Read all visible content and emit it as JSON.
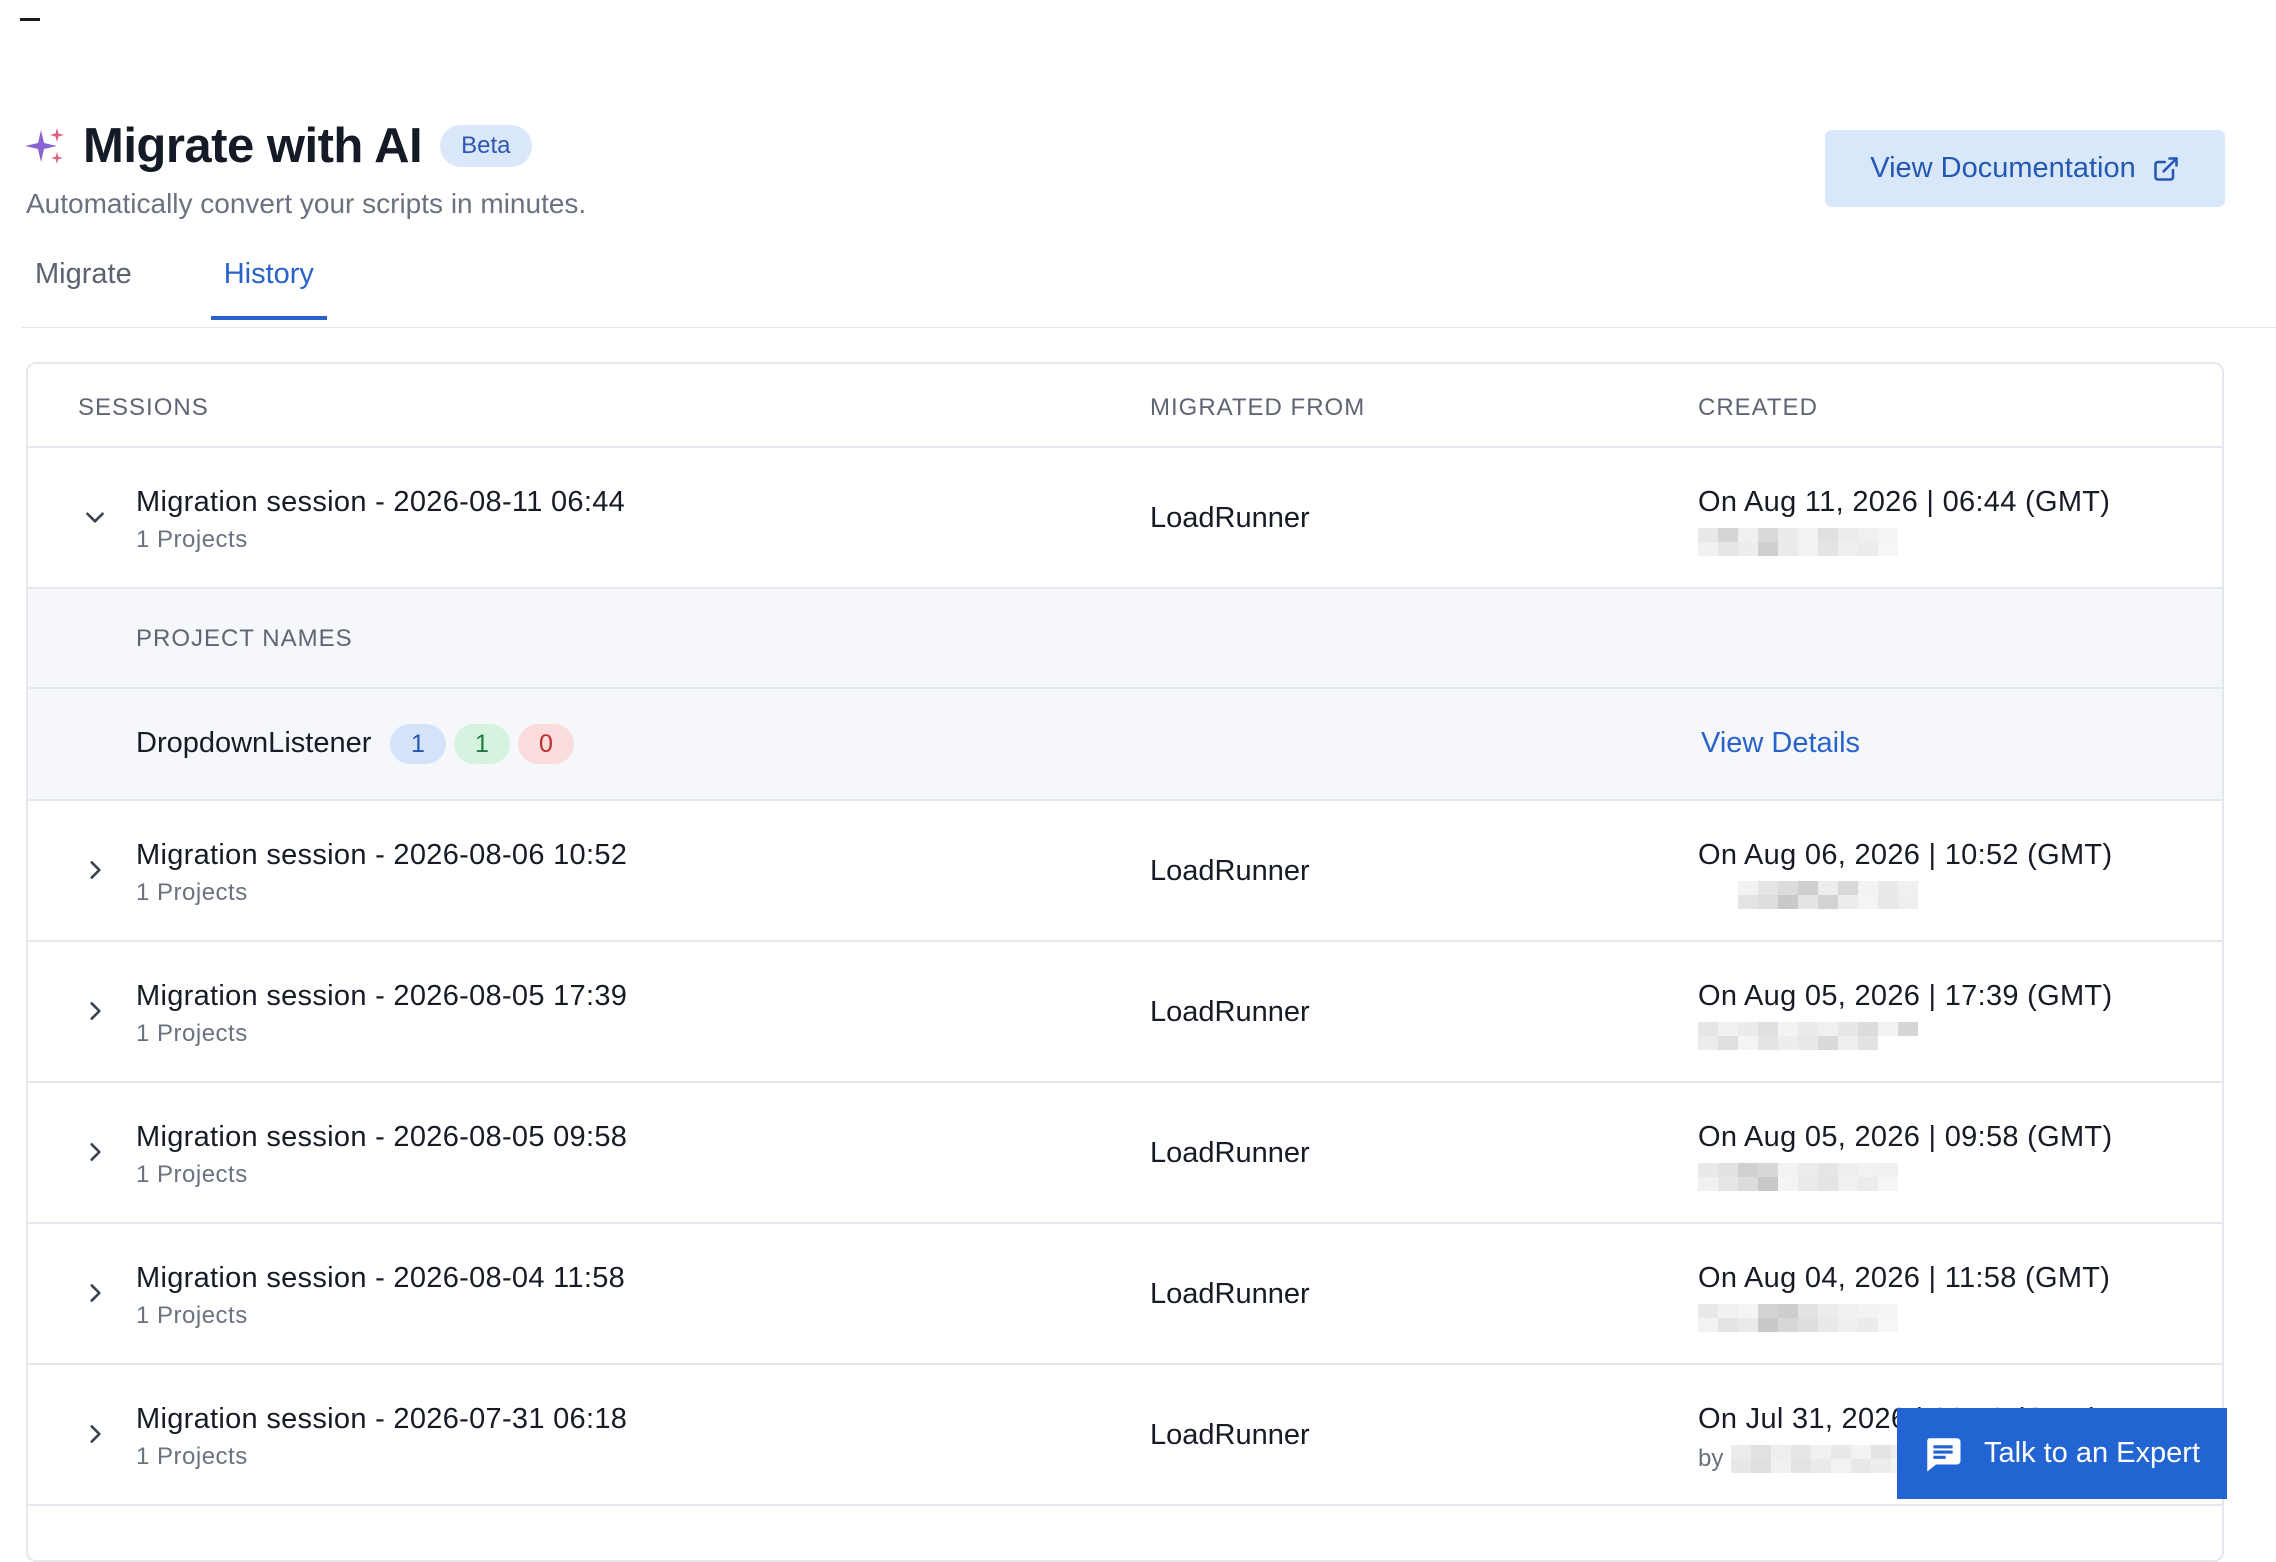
{
  "header": {
    "title": "Migrate with AI",
    "badge": "Beta",
    "subtitle": "Automatically convert your scripts in minutes.",
    "doc_button": "View Documentation"
  },
  "tabs": [
    {
      "label": "Migrate",
      "active": false
    },
    {
      "label": "History",
      "active": true
    }
  ],
  "table": {
    "headers": {
      "sessions": "SESSIONS",
      "migrated_from": "MIGRATED FROM",
      "created": "CREATED"
    },
    "sessions": [
      {
        "name": "Migration session - 2026-08-11 06:44",
        "projects": "1 Projects",
        "source": "LoadRunner",
        "created": "On Aug 11, 2026 | 06:44 (GMT)",
        "by": "",
        "expanded": true
      },
      {
        "name": "Migration session - 2026-08-06 10:52",
        "projects": "1 Projects",
        "source": "LoadRunner",
        "created": "On Aug 06, 2026 | 10:52 (GMT)",
        "by": "",
        "expanded": false
      },
      {
        "name": "Migration session - 2026-08-05 17:39",
        "projects": "1 Projects",
        "source": "LoadRunner",
        "created": "On Aug 05, 2026 | 17:39 (GMT)",
        "by": "",
        "expanded": false
      },
      {
        "name": "Migration session - 2026-08-05 09:58",
        "projects": "1 Projects",
        "source": "LoadRunner",
        "created": "On Aug 05, 2026 | 09:58 (GMT)",
        "by": "",
        "expanded": false
      },
      {
        "name": "Migration session - 2026-08-04 11:58",
        "projects": "1 Projects",
        "source": "LoadRunner",
        "created": "On Aug 04, 2026 | 11:58 (GMT)",
        "by": "",
        "expanded": false
      },
      {
        "name": "Migration session - 2026-07-31 06:18",
        "projects": "1 Projects",
        "source": "LoadRunner",
        "created": "On Jul 31, 2026 | 06:18 (GMT)",
        "by": "by",
        "expanded": false
      }
    ],
    "project_panel": {
      "header": "PROJECT NAMES",
      "project": {
        "name": "DropdownListener",
        "counts": [
          "1",
          "1",
          "0"
        ],
        "link": "View Details"
      }
    }
  },
  "expert_button": {
    "label": "Talk to an Expert"
  },
  "colors": {
    "accent": "#2a62cc",
    "expert_bg": "#2264d1",
    "doc_button_bg": "#d9e7fb"
  }
}
